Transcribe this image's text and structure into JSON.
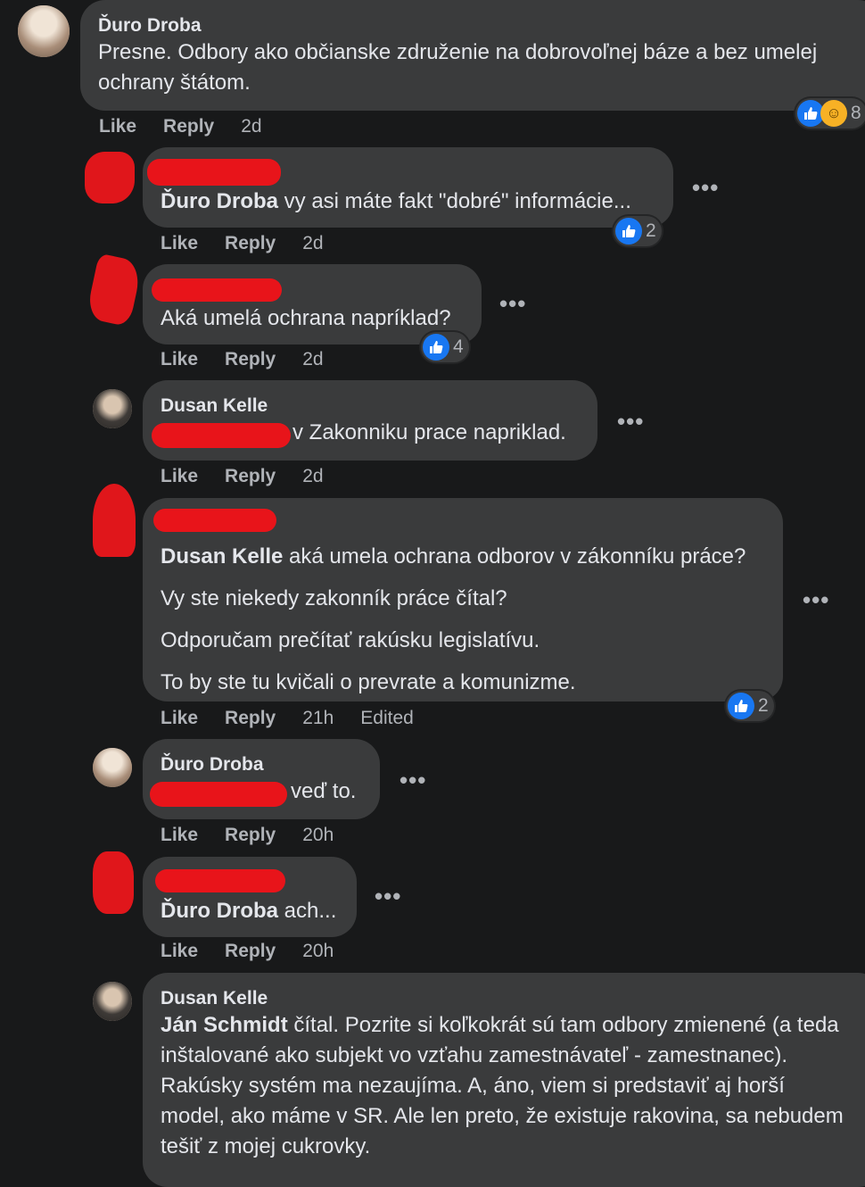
{
  "comments": [
    {
      "author": "Ďuro Droba",
      "text": "Presne. Odbory ako občianske združenie na dobrovoľnej báze a bez umelej ochrany štátom.",
      "actions": {
        "like": "Like",
        "reply": "Reply",
        "time": "2d"
      },
      "reaction_count": "8"
    },
    {
      "author": "",
      "mention": "Ďuro Droba",
      "text": " vy asi máte fakt \"dobré\" informácie...",
      "actions": {
        "like": "Like",
        "reply": "Reply",
        "time": "2d"
      },
      "reaction_count": "2"
    },
    {
      "author": "",
      "text": "Aká umelá ochrana napríklad?",
      "actions": {
        "like": "Like",
        "reply": "Reply",
        "time": "2d"
      },
      "reaction_count": "4"
    },
    {
      "author": "Dusan Kelle",
      "text": "v Zakonniku prace napriklad.",
      "actions": {
        "like": "Like",
        "reply": "Reply",
        "time": "2d"
      }
    },
    {
      "author": "",
      "mention": "Dusan Kelle",
      "lines": [
        " aká umela ochrana odborov v zákonníku práce?",
        "Vy ste niekedy zakonník práce čítal?",
        "Odporučam prečítať rakúsku legislatívu.",
        "To by ste tu kvičali o prevrate a komunizme."
      ],
      "actions": {
        "like": "Like",
        "reply": "Reply",
        "time": "21h",
        "edited": "Edited"
      },
      "reaction_count": "2"
    },
    {
      "author": "Ďuro Droba",
      "text": "veď to.",
      "actions": {
        "like": "Like",
        "reply": "Reply",
        "time": "20h"
      }
    },
    {
      "author": "",
      "mention": "Ďuro Droba",
      "text": " ach...",
      "actions": {
        "like": "Like",
        "reply": "Reply",
        "time": "20h"
      }
    },
    {
      "author": "Dusan Kelle",
      "mention": "Ján Schmidt",
      "text": " čítal. Pozrite si koľkokrát sú tam odbory zmienené (a teda inštalované ako subjekt vo vzťahu zamestnávateľ - zamestnanec). Rakúsky systém ma nezaujíma. A, áno, viem si predstaviť aj horší model, ako máme v SR. Ale len preto, že existuje rakovina, sa nebudem tešiť z mojej cukrovky."
    }
  ],
  "more_label": "•••",
  "colors": {
    "background": "#18191a",
    "bubble": "#3a3b3c",
    "like_blue": "#1877f2",
    "redaction": "#e8141a"
  }
}
